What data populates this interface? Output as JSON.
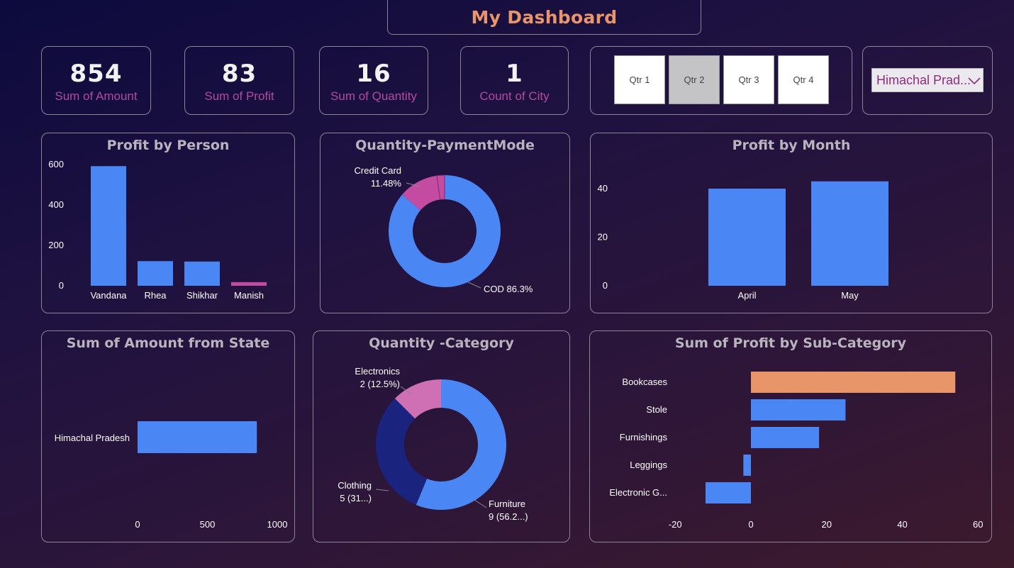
{
  "page": {
    "title": "My Dashboard"
  },
  "kpis": [
    {
      "value": "854",
      "label": "Sum of Amount"
    },
    {
      "value": "83",
      "label": "Sum of Profit"
    },
    {
      "value": "16",
      "label": "Sum of Quantity"
    },
    {
      "value": "1",
      "label": "Count of City"
    }
  ],
  "quarter_slicer": {
    "options": [
      "Qtr 1",
      "Qtr 2",
      "Qtr 3",
      "Qtr 4"
    ],
    "selected": "Qtr 2"
  },
  "state_dropdown": {
    "value": "Himachal Prad..."
  },
  "colors": {
    "accent": "#e8956a",
    "bar": "#4a86f4",
    "magenta": "#c44ba2",
    "navy": "#1a237e",
    "pink": "#d070b4",
    "label": "#b24a9e"
  },
  "chart_data": [
    {
      "id": "profit_by_person",
      "type": "bar",
      "title": "Profit by Person",
      "categories": [
        "Vandana",
        "Rhea",
        "Shikhar",
        "Manish"
      ],
      "values": [
        592,
        122,
        120,
        18
      ],
      "yticks": [
        "600",
        "400",
        "200",
        "0"
      ],
      "ylim": [
        0,
        600
      ]
    },
    {
      "id": "quantity_paymentmode",
      "type": "pie",
      "title": "Quantity-PaymentMode",
      "slices": [
        {
          "name": "COD",
          "label": "COD 86.3%",
          "value": 86.3
        },
        {
          "name": "Credit Card",
          "label": "Credit Card",
          "pct_label": "11.48%",
          "value": 11.48
        },
        {
          "name": "Other",
          "value": 2.22
        }
      ]
    },
    {
      "id": "profit_by_month",
      "type": "bar",
      "title": "Profit by Month",
      "categories": [
        "April",
        "May"
      ],
      "values": [
        40,
        43
      ],
      "yticks": [
        "40",
        "20",
        "0"
      ],
      "ylim": [
        0,
        40
      ]
    },
    {
      "id": "amount_from_state",
      "type": "bar",
      "title": "Sum of Amount from State",
      "categories": [
        "Himachal Pradesh"
      ],
      "values": [
        854
      ],
      "xticks": [
        "0",
        "500",
        "1000"
      ],
      "xlim": [
        0,
        1000
      ]
    },
    {
      "id": "quantity_category",
      "type": "pie",
      "title": "Quantity -Category",
      "slices": [
        {
          "name": "Furniture",
          "label1": "Furniture",
          "label2": "9 (56.2...)",
          "value": 9
        },
        {
          "name": "Clothing",
          "label1": "Clothing",
          "label2": "5 (31...)",
          "value": 5
        },
        {
          "name": "Electronics",
          "label1": "Electronics",
          "label2": "2 (12.5%)",
          "value": 2
        }
      ]
    },
    {
      "id": "profit_by_subcategory",
      "type": "bar",
      "title": "Sum of Profit by Sub-Category",
      "categories": [
        "Bookcases",
        "Stole",
        "Furnishings",
        "Leggings",
        "Electronic G..."
      ],
      "values": [
        54,
        25,
        18,
        -2,
        -12
      ],
      "xticks": [
        "-20",
        "0",
        "20",
        "40",
        "60"
      ],
      "xlim": [
        -20,
        60
      ]
    }
  ]
}
